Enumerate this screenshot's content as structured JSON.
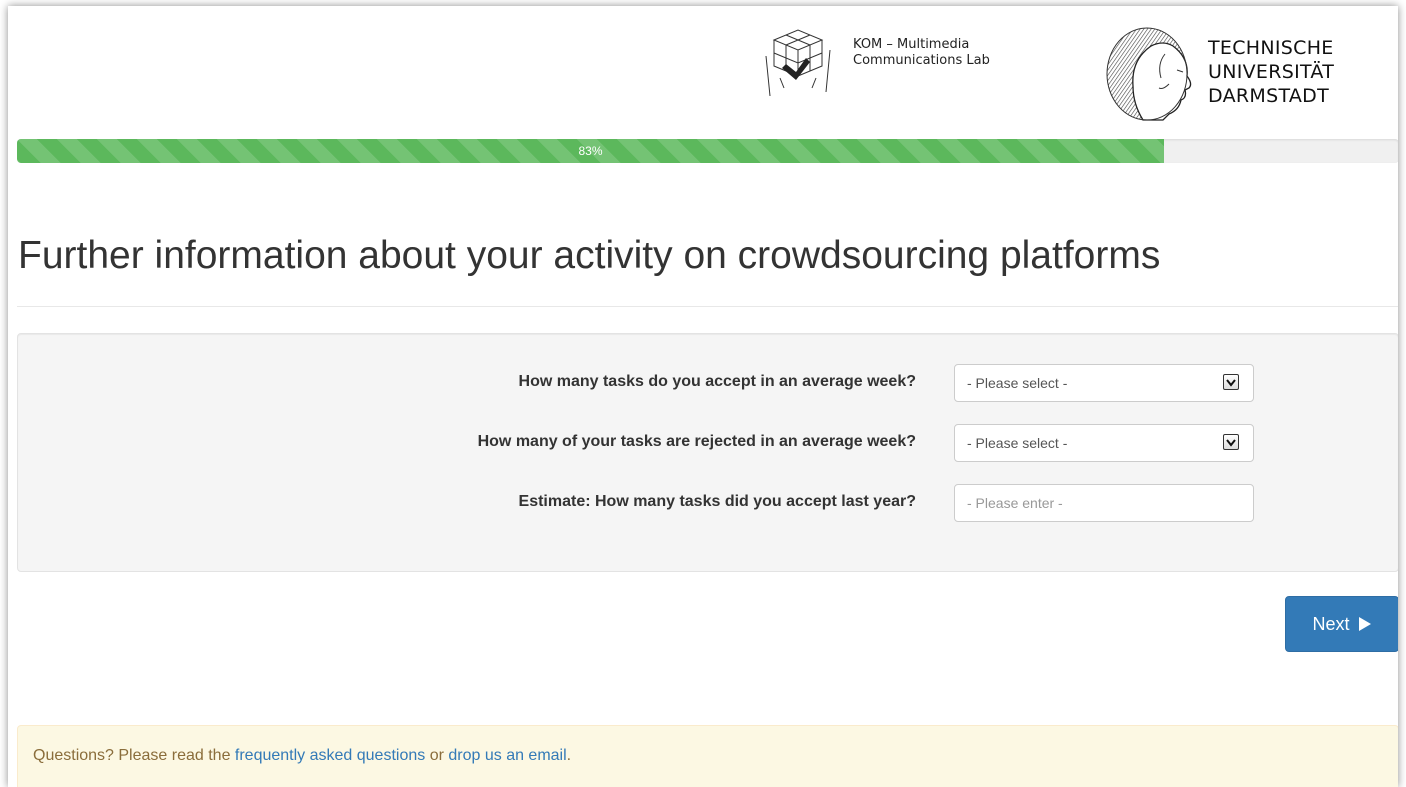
{
  "header": {
    "kom_line1": "KOM – Multimedia",
    "kom_line2": "Communications Lab",
    "tud_line1": "TECHNISCHE",
    "tud_line2": "UNIVERSITÄT",
    "tud_line3": "DARMSTADT"
  },
  "progress": {
    "value": 0.83,
    "label": "83%",
    "color": "#5cb85c"
  },
  "title": "Further information about your activity on crowdsourcing platforms",
  "questions": [
    {
      "label": "How many tasks do you accept in an average week?",
      "value": "- Please select -"
    },
    {
      "label": "How many of your tasks are rejected in an average week?",
      "value": "- Please select -"
    },
    {
      "label": "Estimate: How many tasks did you accept last year?",
      "placeholder": "- Please enter -"
    }
  ],
  "next_button": {
    "label": "Next",
    "icon": "play-triangle-icon",
    "color": "#337ab7"
  },
  "footer": {
    "text1": "Questions? Please read the ",
    "link1": "frequently asked questions",
    "text2": " or ",
    "link2": "drop us an email",
    "text3": "."
  }
}
